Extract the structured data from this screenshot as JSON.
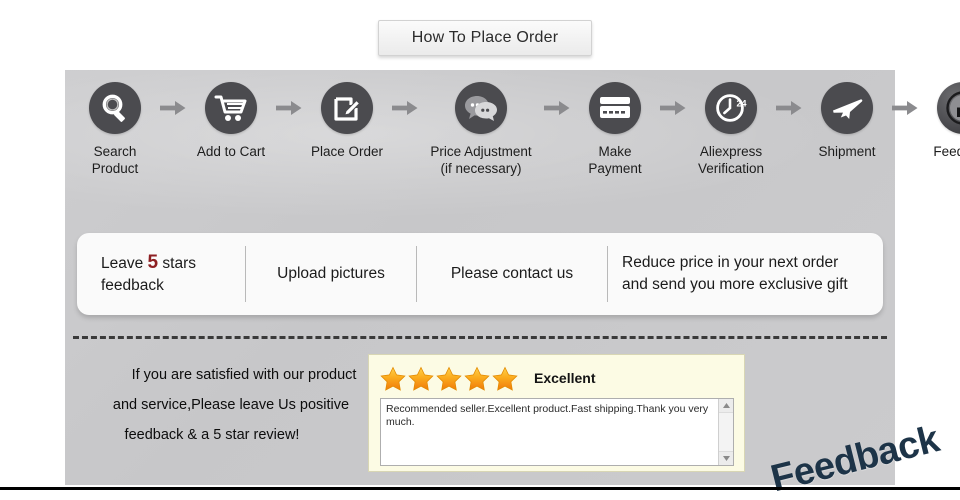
{
  "header": {
    "title": "How To Place Order"
  },
  "steps": [
    {
      "label": "Search\nProduct",
      "icon": "magnifier-icon",
      "width": "narrow"
    },
    {
      "label": "Add to Cart",
      "icon": "shopping-cart-icon",
      "width": "narrow"
    },
    {
      "label": "Place Order",
      "icon": "edit-pencil-icon",
      "width": "narrow"
    },
    {
      "label": "Price Adjustment\n(if necessary)",
      "icon": "chat-bubbles-icon",
      "width": "wide"
    },
    {
      "label": "Make\nPayment",
      "icon": "credit-card-icon",
      "width": "narrow"
    },
    {
      "label": "Aliexpress\nVerification",
      "icon": "clock-24-icon",
      "width": "narrow"
    },
    {
      "label": "Shipment",
      "icon": "airplane-icon",
      "width": "narrow"
    },
    {
      "label": "Feedback",
      "icon": "thumbs-up-icon",
      "width": "narrow"
    }
  ],
  "arrow_icon": "arrow-right-icon",
  "promise_band": {
    "items": [
      {
        "prefix": "Leave ",
        "highlight": "5",
        "suffix": " stars\nfeedback"
      },
      {
        "text": "Upload pictures"
      },
      {
        "text": "Please contact us"
      },
      {
        "text": "Reduce  price in your next order\nand send you more exclusive gift"
      }
    ]
  },
  "bottom": {
    "message_line1": "If you are satisfied with our product",
    "message_line2": "and service,Please leave Us positive",
    "message_line3": "feedback & a 5 star review!",
    "review": {
      "star_count": 5,
      "rating_label": "Excellent",
      "review_text": "Recommended seller.Excellent product.Fast shipping.Thank you very much.",
      "star_icon": "star-filled-icon",
      "scroll_up_icon": "scroll-up-arrow-icon",
      "scroll_down_icon": "scroll-down-arrow-icon"
    },
    "watermark": "Feedback"
  },
  "colors": {
    "panel_bg": "#c9c9cb",
    "icon_dark": "#4b4b4f",
    "highlight_red": "#8d1f22",
    "star_gold": "#f7a01c",
    "review_bg": "#fcfbe4",
    "watermark_navy": "#1d3448"
  }
}
